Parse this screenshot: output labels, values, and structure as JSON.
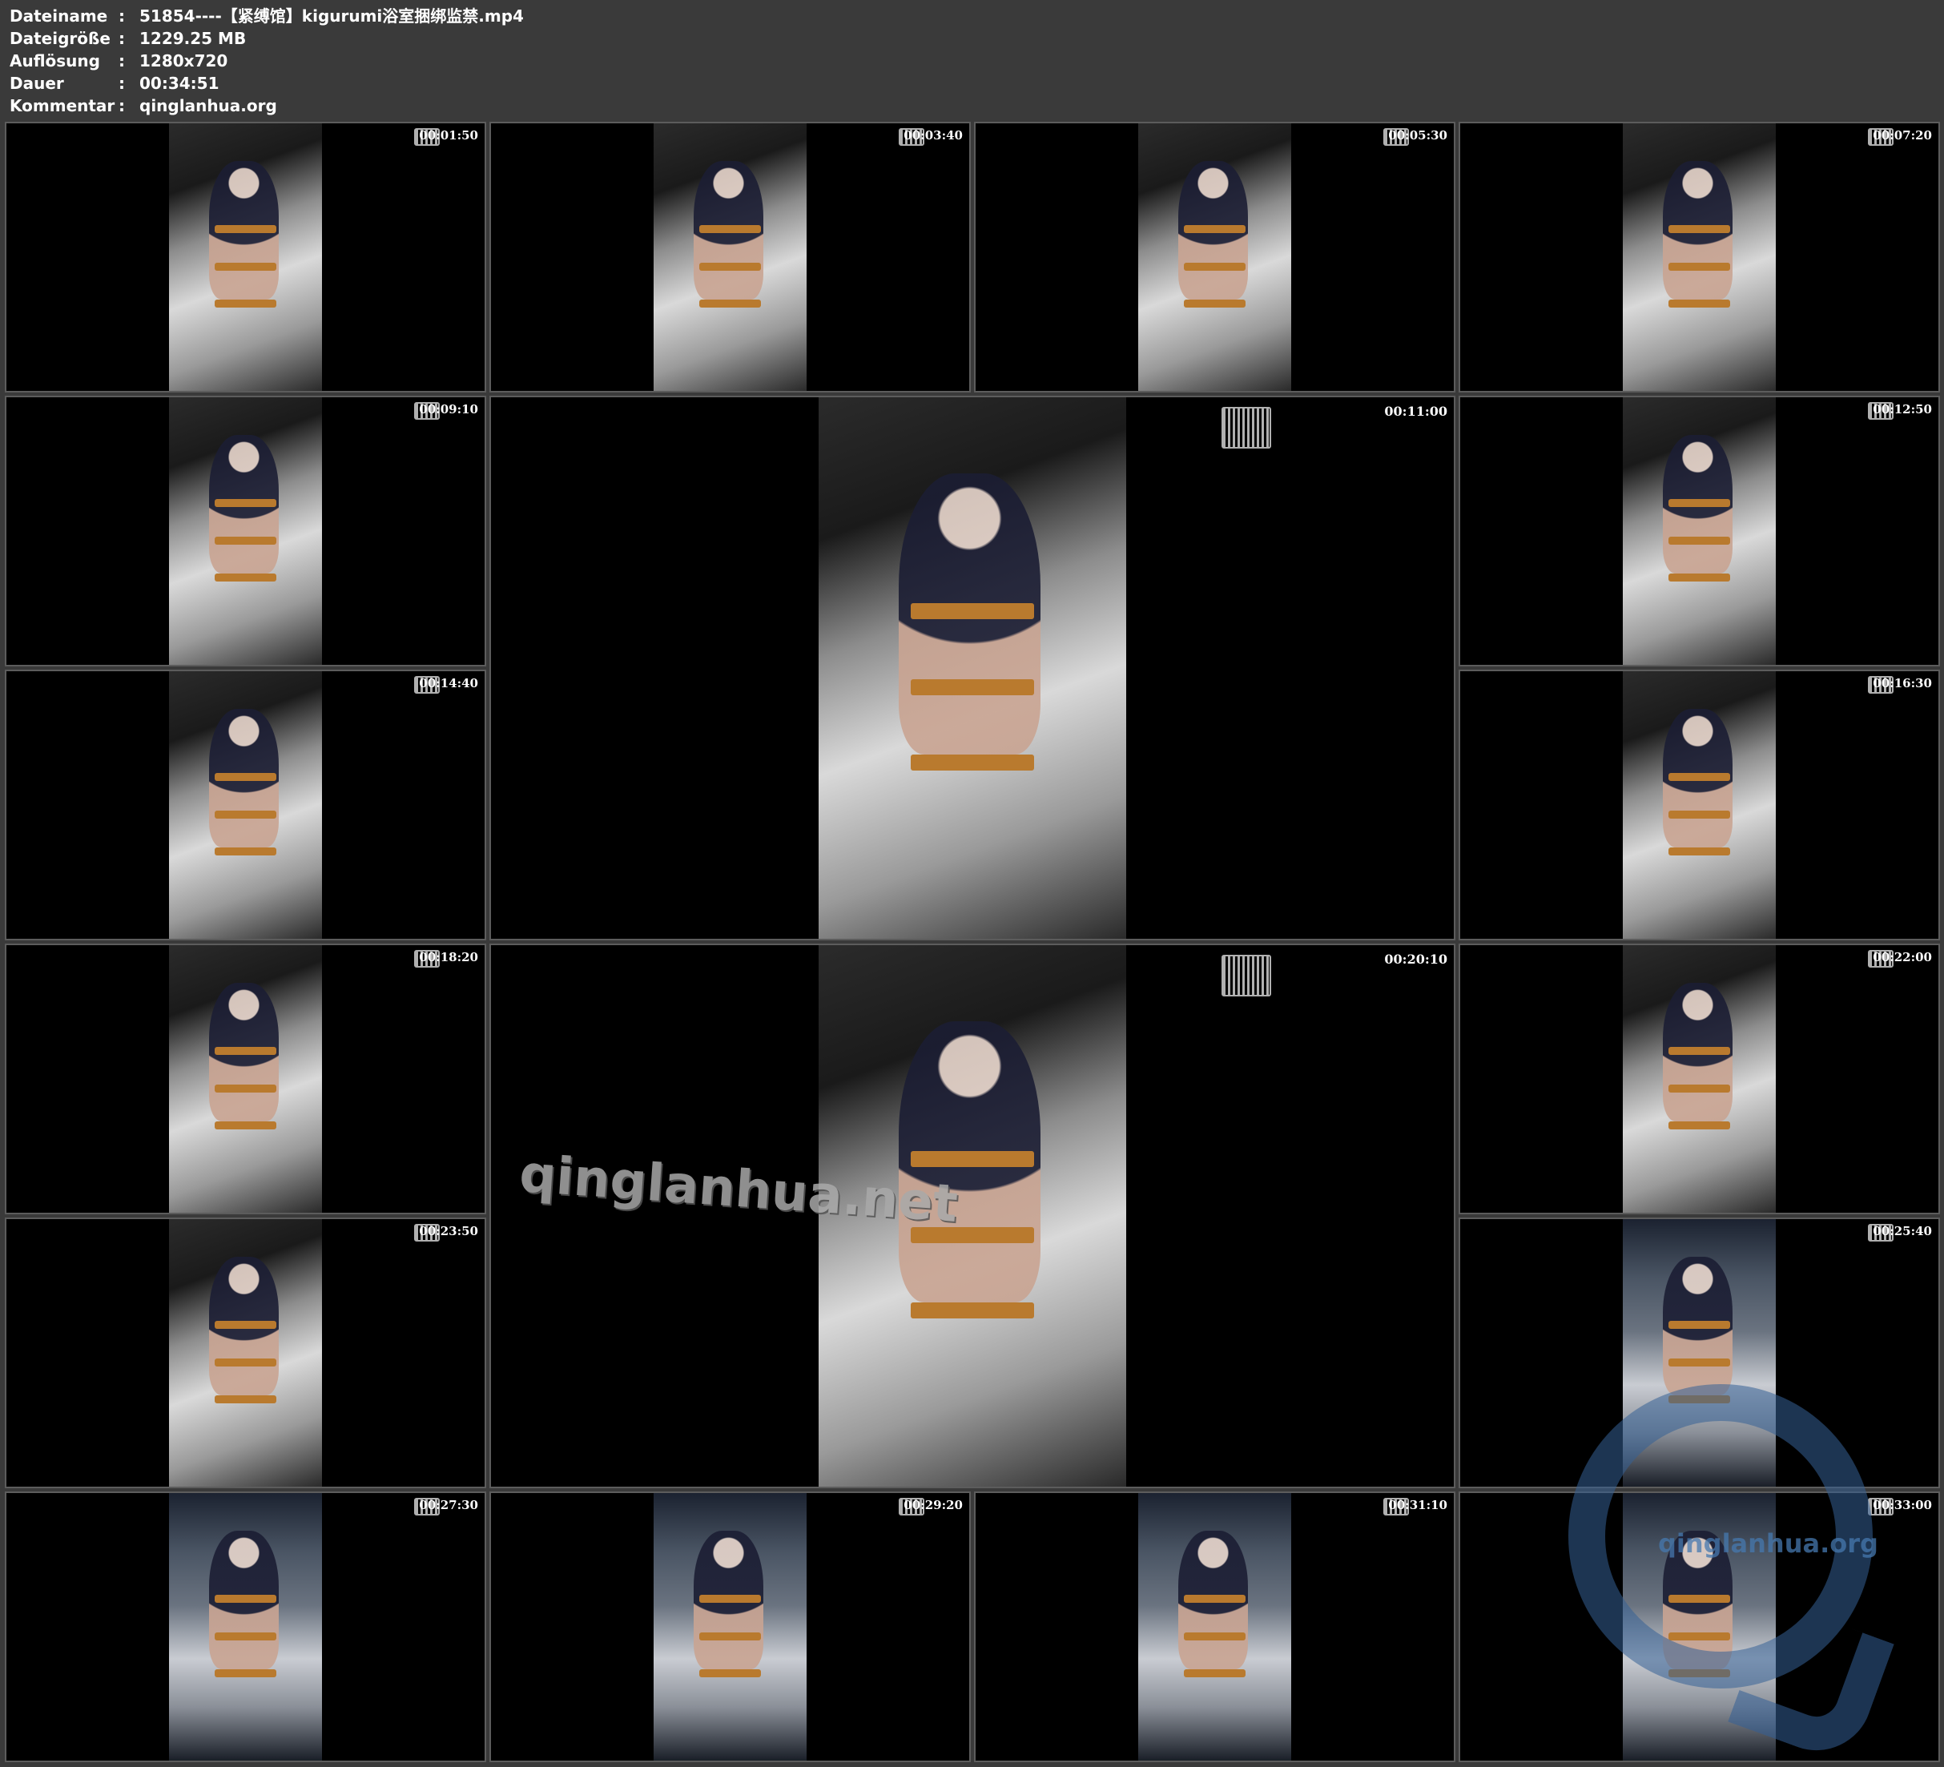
{
  "header": {
    "rows": [
      {
        "label": "Dateiname",
        "value": "51854----【紧缚馆】kigurumi浴室捆绑监禁.mp4"
      },
      {
        "label": "Dateigröße",
        "value": "1229.25 MB"
      },
      {
        "label": "Auflösung",
        "value": "1280x720"
      },
      {
        "label": "Dauer",
        "value": "00:34:51"
      },
      {
        "label": "Kommentar",
        "value": "qinglanhua.org"
      }
    ]
  },
  "thumbnails": [
    {
      "time": "00:01:50",
      "scene": "bathtub"
    },
    {
      "time": "00:03:40",
      "scene": "bathtub"
    },
    {
      "time": "00:05:30",
      "scene": "bathtub"
    },
    {
      "time": "00:07:20",
      "scene": "bathtub"
    },
    {
      "time": "00:09:10",
      "scene": "bathtub"
    },
    {
      "time": "00:11:00",
      "scene": "bathtub",
      "large": true
    },
    {
      "time": "00:12:50",
      "scene": "bathtub"
    },
    {
      "time": "00:14:40",
      "scene": "bathtub"
    },
    {
      "time": "00:16:30",
      "scene": "bathtub"
    },
    {
      "time": "00:18:20",
      "scene": "bathtub"
    },
    {
      "time": "00:20:10",
      "scene": "bathtub",
      "large": true
    },
    {
      "time": "00:22:00",
      "scene": "bathtub"
    },
    {
      "time": "00:23:50",
      "scene": "bathtub"
    },
    {
      "time": "00:25:40",
      "scene": "shower"
    },
    {
      "time": "00:27:30",
      "scene": "shower"
    },
    {
      "time": "00:29:20",
      "scene": "shower"
    },
    {
      "time": "00:31:10",
      "scene": "shower"
    },
    {
      "time": "00:33:00",
      "scene": "shower"
    }
  ],
  "watermarks": {
    "center_text": "qinglanhua.net",
    "corner_text": "qinglanhua.org",
    "colors": {
      "corner": "#34609a",
      "center": "#a9a9a9"
    }
  },
  "icons": {
    "frame_logo": "video-editor-logo-icon"
  }
}
